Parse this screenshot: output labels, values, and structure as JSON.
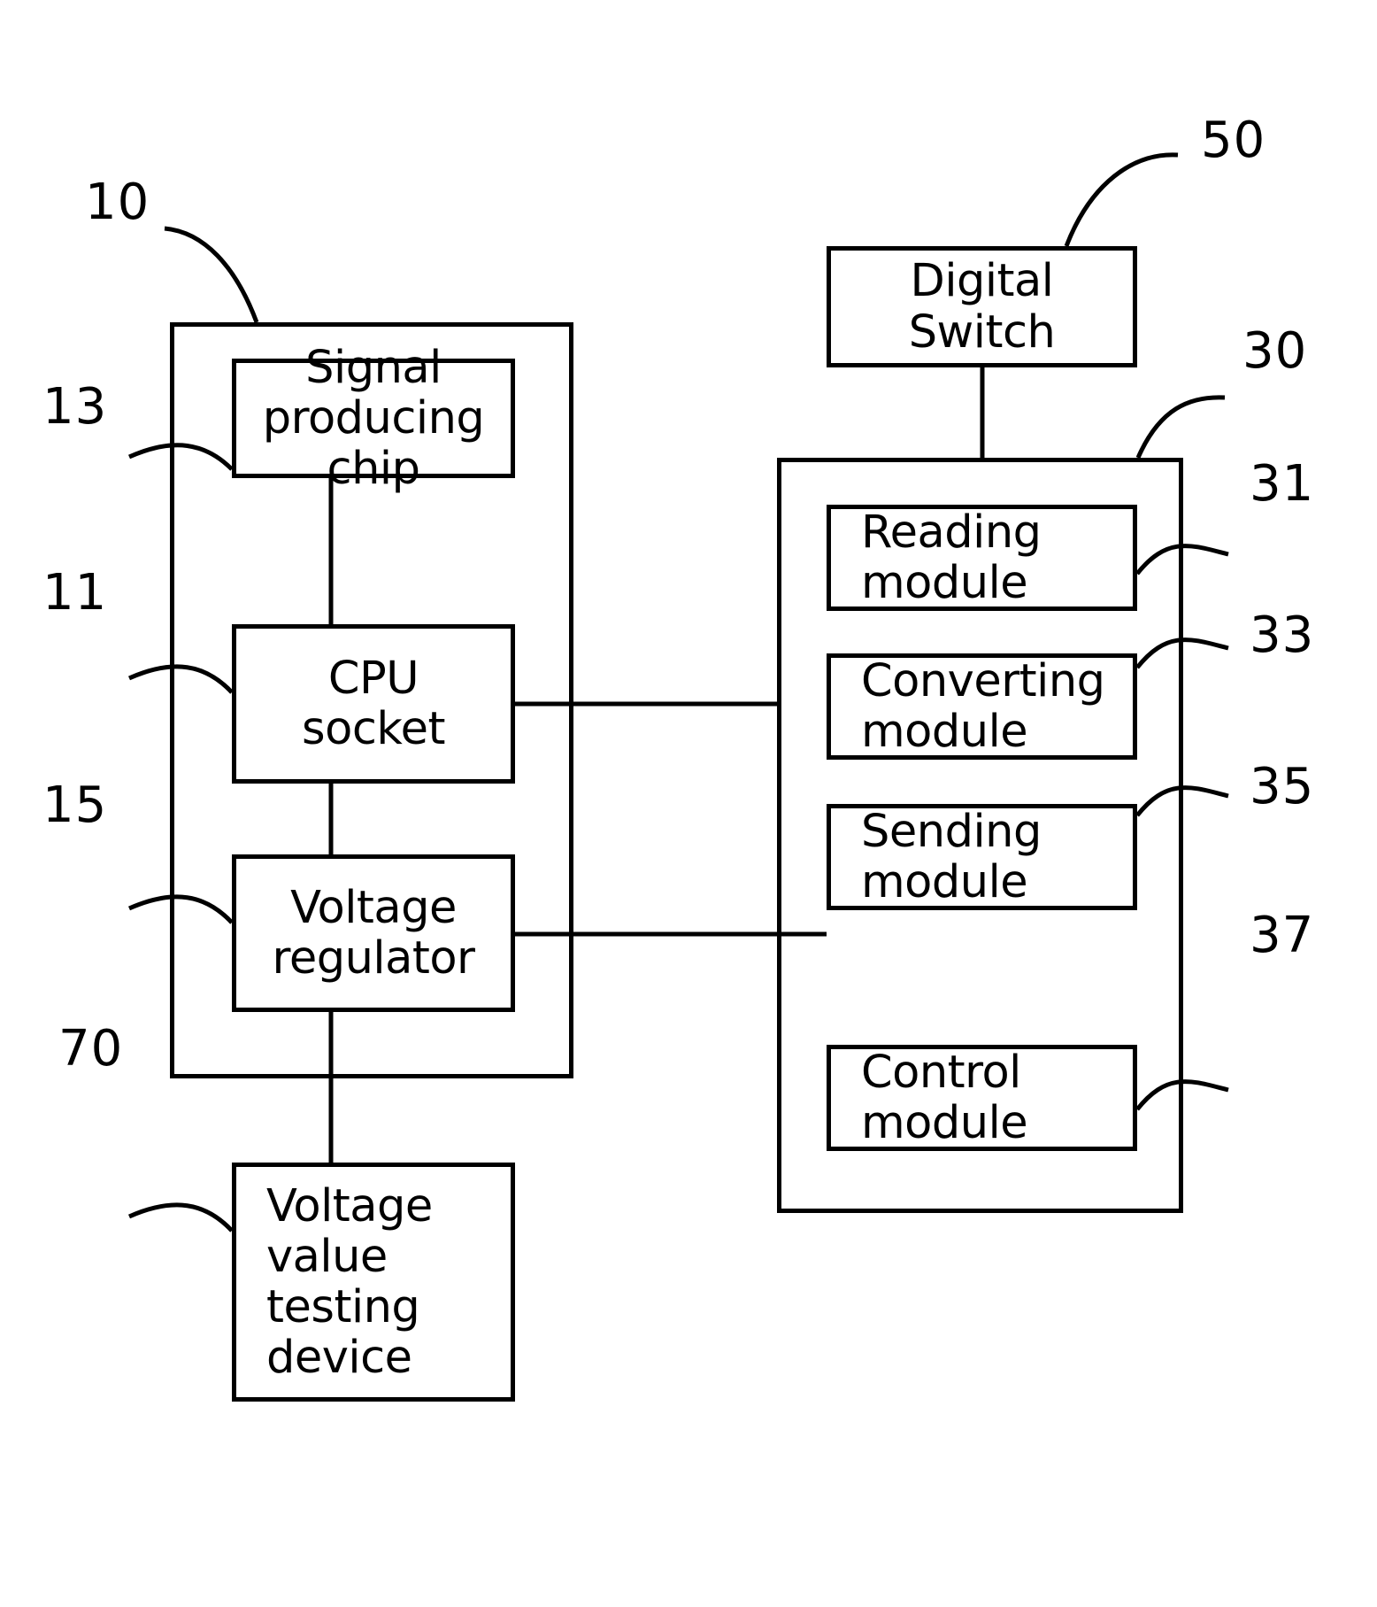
{
  "figure": {
    "title": "CPU voltage testing system block diagram",
    "line_color": "#000000",
    "background_color": "#ffffff"
  },
  "boxes": {
    "signal_producing_chip": {
      "label": "Signal\nproducing\nchip",
      "ref": "13"
    },
    "cpu_socket": {
      "label": "CPU\nsocket",
      "ref": "11"
    },
    "voltage_regulator": {
      "label": "Voltage\nregulator",
      "ref": "15"
    },
    "voltage_value_testing_device": {
      "label": "Voltage\nvalue\ntesting\ndevice",
      "ref": "70"
    },
    "digital_switch": {
      "label": "Digital\nSwitch",
      "ref": "50"
    },
    "reading_module": {
      "label": "Reading\nmodule",
      "ref": "31"
    },
    "converting_module": {
      "label": "Converting\nmodule",
      "ref": "33"
    },
    "sending_module": {
      "label": "Sending\nmodule",
      "ref": "35"
    },
    "control_module": {
      "label": "Control\nmodule",
      "ref": "37"
    }
  },
  "containers": {
    "motherboard": {
      "ref": "10"
    },
    "test_device": {
      "ref": "30"
    }
  },
  "reference_numerals": {
    "n10": "10",
    "n13": "13",
    "n11": "11",
    "n15": "15",
    "n70": "70",
    "n50": "50",
    "n30": "30",
    "n31": "31",
    "n33": "33",
    "n35": "35",
    "n37": "37"
  }
}
